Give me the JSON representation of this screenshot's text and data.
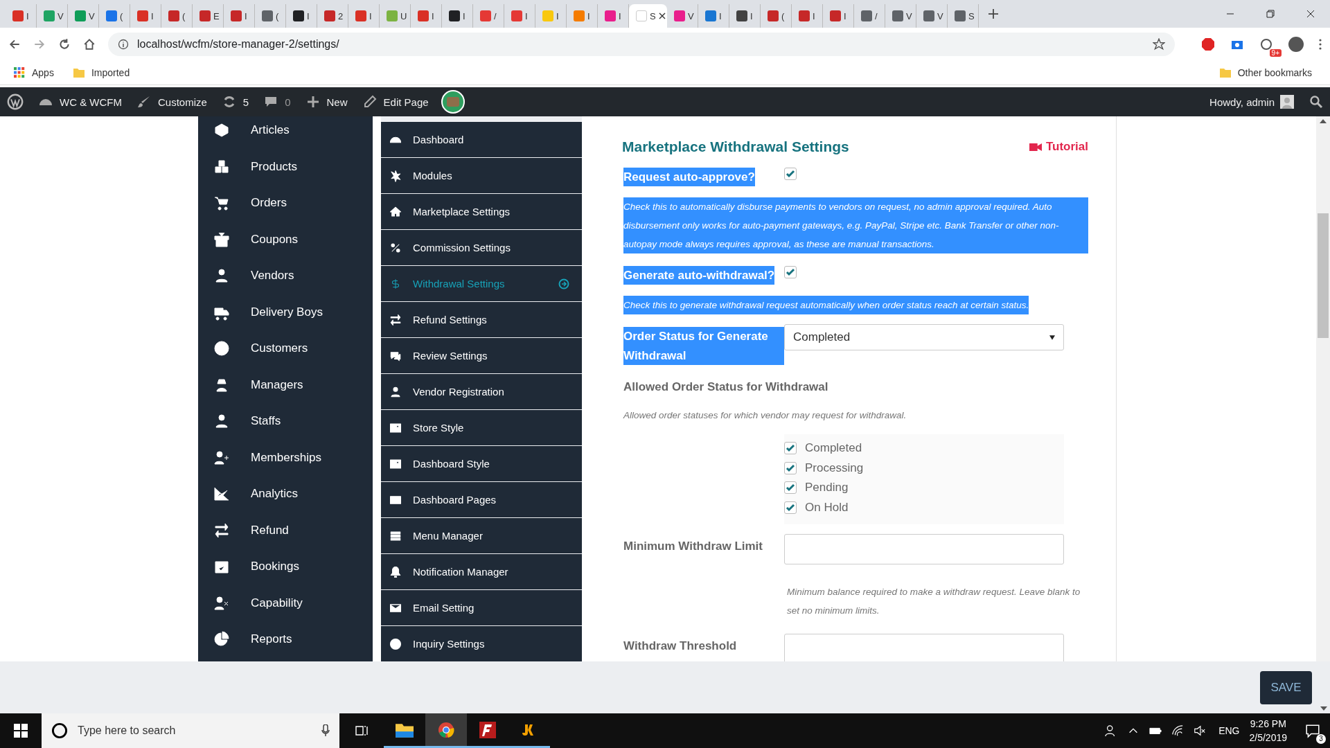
{
  "browser": {
    "tabs": [
      {
        "title": "I",
        "selected": false,
        "color": "#d93025"
      },
      {
        "title": "V",
        "selected": false,
        "color": "#1fa463"
      },
      {
        "title": "V",
        "selected": false,
        "color": "#0f9d58"
      },
      {
        "title": "(",
        "selected": false,
        "color": "#1a73e8"
      },
      {
        "title": "I",
        "selected": false,
        "color": "#d93025"
      },
      {
        "title": "(",
        "selected": false,
        "color": "#c62828"
      },
      {
        "title": "E",
        "selected": false,
        "color": "#c62828"
      },
      {
        "title": "I",
        "selected": false,
        "color": "#c62828"
      },
      {
        "title": "(",
        "selected": false,
        "color": "#5f6368"
      },
      {
        "title": "I",
        "selected": false,
        "color": "#202124"
      },
      {
        "title": "2",
        "selected": false,
        "color": "#c62828"
      },
      {
        "title": "I",
        "selected": false,
        "color": "#d93025"
      },
      {
        "title": "U",
        "selected": false,
        "color": "#7cb342"
      },
      {
        "title": "I",
        "selected": false,
        "color": "#d93025"
      },
      {
        "title": "I",
        "selected": false,
        "color": "#202124"
      },
      {
        "title": "/",
        "selected": false,
        "color": "#e53935"
      },
      {
        "title": "I",
        "selected": false,
        "color": "#e53935"
      },
      {
        "title": "I",
        "selected": false,
        "color": "#f9c80e"
      },
      {
        "title": "I",
        "selected": false,
        "color": "#f57c00"
      },
      {
        "title": "I",
        "selected": false,
        "color": "#e91e8c"
      },
      {
        "title": "S",
        "selected": true,
        "color": "#ffffff"
      },
      {
        "title": "V",
        "selected": false,
        "color": "#e91e8c"
      },
      {
        "title": "I",
        "selected": false,
        "color": "#1976d2"
      },
      {
        "title": "I",
        "selected": false,
        "color": "#424242"
      },
      {
        "title": "(",
        "selected": false,
        "color": "#c62828"
      },
      {
        "title": "I",
        "selected": false,
        "color": "#c62828"
      },
      {
        "title": "I",
        "selected": false,
        "color": "#c62828"
      },
      {
        "title": "/",
        "selected": false,
        "color": "#5f6368"
      },
      {
        "title": "V",
        "selected": false,
        "color": "#5f6368"
      },
      {
        "title": "V",
        "selected": false,
        "color": "#5f6368"
      },
      {
        "title": "S",
        "selected": false,
        "color": "#5f6368"
      }
    ],
    "address": "localhost/wcfm/store-manager-2/settings/",
    "extension_badge": "9+",
    "bookmarks": [
      "Apps",
      "Imported"
    ],
    "other_bookmarks": "Other bookmarks"
  },
  "admin_bar": {
    "items": [
      {
        "kind": "site",
        "label": "WC & WCFM"
      },
      {
        "kind": "customize",
        "label": "Customize"
      },
      {
        "kind": "updates",
        "label": "5"
      },
      {
        "kind": "comments",
        "label": "0"
      },
      {
        "kind": "new",
        "label": "New"
      },
      {
        "kind": "edit",
        "label": "Edit Page"
      }
    ],
    "greeting": "Howdy, admin"
  },
  "sidebar": {
    "items": [
      "Articles",
      "Products",
      "Orders",
      "Coupons",
      "Vendors",
      "Delivery Boys",
      "Customers",
      "Managers",
      "Staffs",
      "Memberships",
      "Analytics",
      "Refund",
      "Bookings",
      "Capability",
      "Reports"
    ]
  },
  "settings_menu": {
    "items": [
      {
        "label": "Dashboard",
        "selected": false
      },
      {
        "label": "Modules",
        "selected": false
      },
      {
        "label": "Marketplace Settings",
        "selected": false
      },
      {
        "label": "Commission Settings",
        "selected": false
      },
      {
        "label": "Withdrawal Settings",
        "selected": true
      },
      {
        "label": "Refund Settings",
        "selected": false
      },
      {
        "label": "Review Settings",
        "selected": false
      },
      {
        "label": "Vendor Registration",
        "selected": false
      },
      {
        "label": "Store Style",
        "selected": false
      },
      {
        "label": "Dashboard Style",
        "selected": false
      },
      {
        "label": "Dashboard Pages",
        "selected": false
      },
      {
        "label": "Menu Manager",
        "selected": false
      },
      {
        "label": "Notification Manager",
        "selected": false
      },
      {
        "label": "Email Setting",
        "selected": false
      },
      {
        "label": "Inquiry Settings",
        "selected": false
      }
    ]
  },
  "panel": {
    "title": "Marketplace Withdrawal Settings",
    "tutorial": "Tutorial",
    "fields": [
      {
        "kind": "checkbox",
        "label": "Request auto-approve?",
        "checked": true,
        "highlighted": true,
        "description": "Check this to automatically disburse payments to vendors on request, no admin approval required. Auto disbursement only works for auto-payment gateways, e.g. PayPal, Stripe etc. Bank Transfer or other non-autopay mode always requires approval, as these are manual transactions."
      },
      {
        "kind": "checkbox",
        "label": "Generate auto-withdrawal?",
        "checked": true,
        "highlighted": true,
        "description": "Check this to generate withdrawal request automatically when order status reach at certain status."
      },
      {
        "kind": "select",
        "label": "Order Status for Generate Withdrawal",
        "value": "Completed",
        "highlighted": true
      },
      {
        "kind": "checklist",
        "label": "Allowed Order Status for Withdrawal",
        "highlighted": false,
        "description": "Allowed order statuses for which vendor may request for withdrawal.",
        "options": [
          {
            "label": "Completed",
            "checked": true
          },
          {
            "label": "Processing",
            "checked": true
          },
          {
            "label": "Pending",
            "checked": true
          },
          {
            "label": "On Hold",
            "checked": true
          }
        ]
      },
      {
        "kind": "text",
        "label": "Minimum Withdraw Limit",
        "highlighted": false,
        "note": "Minimum balance required to make a withdraw request. Leave blank to set no minimum limits."
      },
      {
        "kind": "text",
        "label": "Withdraw Threshold",
        "highlighted": false
      }
    ]
  },
  "save": "SAVE",
  "taskbar": {
    "search_placeholder": "Type here to search",
    "language": "ENG",
    "time": "9:26 PM",
    "date": "2/5/2019",
    "notifications": "3"
  }
}
